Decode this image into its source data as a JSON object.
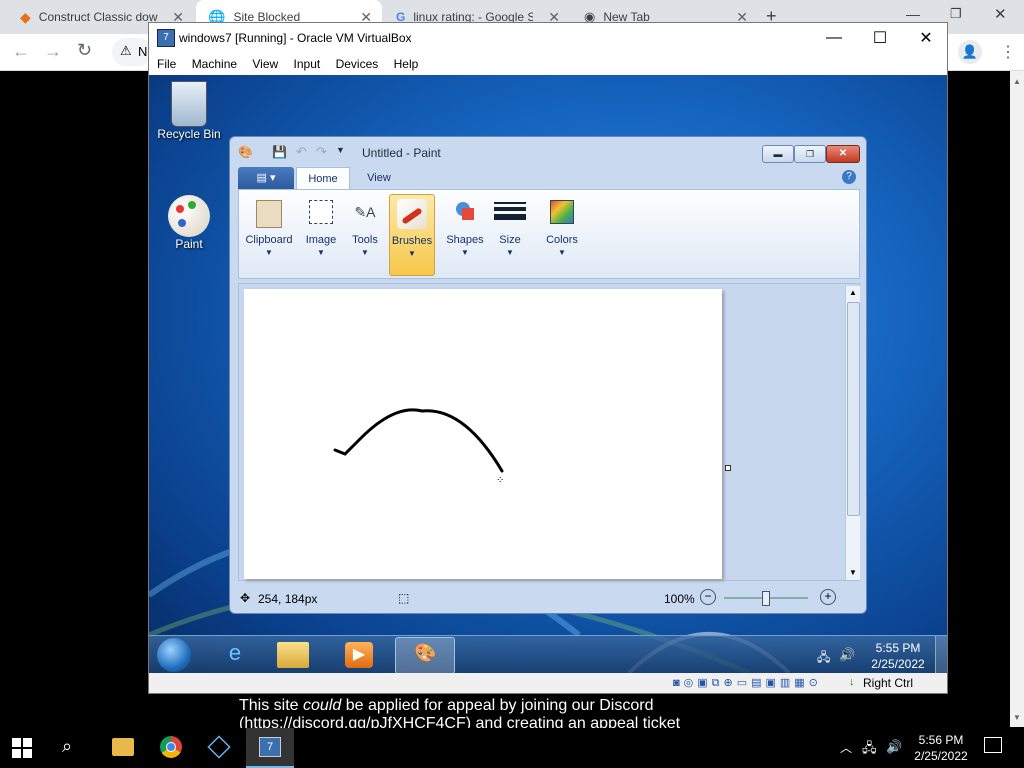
{
  "chrome": {
    "tabs": [
      {
        "title": "Construct Classic dow",
        "icon": "construct-icon",
        "active": false
      },
      {
        "title": "Site Blocked",
        "icon": "globe-icon",
        "active": true
      },
      {
        "title": "linux rating: - Google S",
        "icon": "google-icon",
        "active": false
      },
      {
        "title": "New Tab",
        "icon": "chrome-icon",
        "active": false
      }
    ],
    "omnibox_text": "N"
  },
  "page": {
    "message_line1_a": "This site ",
    "message_line1_em": "could",
    "message_line1_b": " be applied for appeal by joining our Discord",
    "message_line2": "(https://discord.gg/pJfXHCF4CF) and creating an appeal ticket"
  },
  "vbox": {
    "title": "windows7 [Running] - Oracle VM VirtualBox",
    "menu": [
      "File",
      "Machine",
      "View",
      "Input",
      "Devices",
      "Help"
    ],
    "host_key": "Right Ctrl"
  },
  "desktop": {
    "icons": [
      {
        "label": "Recycle Bin",
        "icon": "recycle-bin-icon"
      },
      {
        "label": "Paint",
        "icon": "paint-icon"
      }
    ]
  },
  "paint": {
    "title": "Untitled - Paint",
    "tabs": [
      "Home",
      "View"
    ],
    "groups": [
      "Clipboard",
      "Image",
      "Tools",
      "Brushes",
      "Shapes",
      "Size",
      "Colors"
    ],
    "selected_group": "Brushes",
    "cursor_position": "254, 184px",
    "zoom": "100%"
  },
  "win7_taskbar": {
    "time": "5:55 PM",
    "date": "2/25/2022"
  },
  "win10_taskbar": {
    "time": "5:56 PM",
    "date": "2/25/2022"
  },
  "colors": {
    "win7_blue": "#1565c0",
    "ribbon_highlight": "#f7c84a",
    "taskbar_dark": "#000000"
  }
}
